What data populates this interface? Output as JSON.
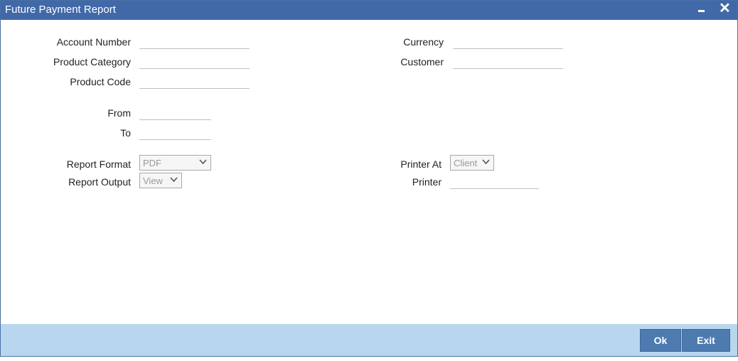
{
  "window": {
    "title": "Future Payment Report"
  },
  "form": {
    "account_number_label": "Account Number",
    "product_category_label": "Product Category",
    "product_code_label": "Product Code",
    "from_label": "From",
    "to_label": "To",
    "currency_label": "Currency",
    "customer_label": "Customer",
    "report_format_label": "Report Format",
    "report_format_value": "PDF",
    "report_output_label": "Report Output",
    "report_output_value": "View",
    "printer_at_label": "Printer At",
    "printer_at_value": "Client",
    "printer_label": "Printer"
  },
  "footer": {
    "ok_label": "Ok",
    "exit_label": "Exit"
  },
  "colors": {
    "titlebar": "#4169a8",
    "footer": "#b8d7ee",
    "button": "#4d7bb0"
  },
  "icons": {
    "minimize": "minimize-icon",
    "close": "close-icon",
    "dropdown": "chevron-down-icon"
  }
}
